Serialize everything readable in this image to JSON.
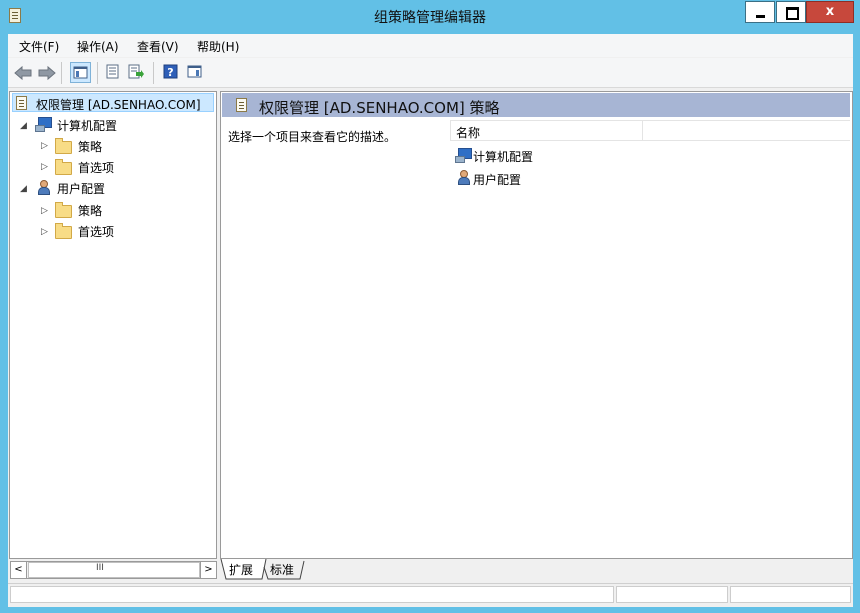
{
  "window": {
    "title": "组策略管理编辑器",
    "close_glyph": "x"
  },
  "menu": [
    {
      "label": "文件(F)"
    },
    {
      "label": "操作(A)"
    },
    {
      "label": "查看(V)"
    },
    {
      "label": "帮助(H)"
    }
  ],
  "toolbar": {
    "buttons": [
      "back-icon",
      "forward-icon",
      "show-hide-console-tree-icon",
      "properties-icon",
      "export-list-icon",
      "help-icon",
      "show-action-pane-icon"
    ]
  },
  "tree": {
    "root": "权限管理 [AD.SENHAO.COM]",
    "computer": {
      "label": "计算机配置",
      "children": [
        "策略",
        "首选项"
      ]
    },
    "user": {
      "label": "用户配置",
      "children": [
        "策略",
        "首选项"
      ]
    }
  },
  "main": {
    "header": "权限管理 [AD.SENHAO.COM] 策略",
    "description": "选择一个项目来查看它的描述。",
    "column_name": "名称",
    "items": [
      "计算机配置",
      "用户配置"
    ]
  },
  "scroll": {
    "left": "<",
    "right": ">",
    "grip": "III"
  },
  "tabs": [
    "扩展",
    "标准"
  ],
  "colors": {
    "titlebar": "#62c0e6",
    "header_bar": "#a7b5d4",
    "selection": "#cce8ff",
    "close": "#c7483c"
  }
}
